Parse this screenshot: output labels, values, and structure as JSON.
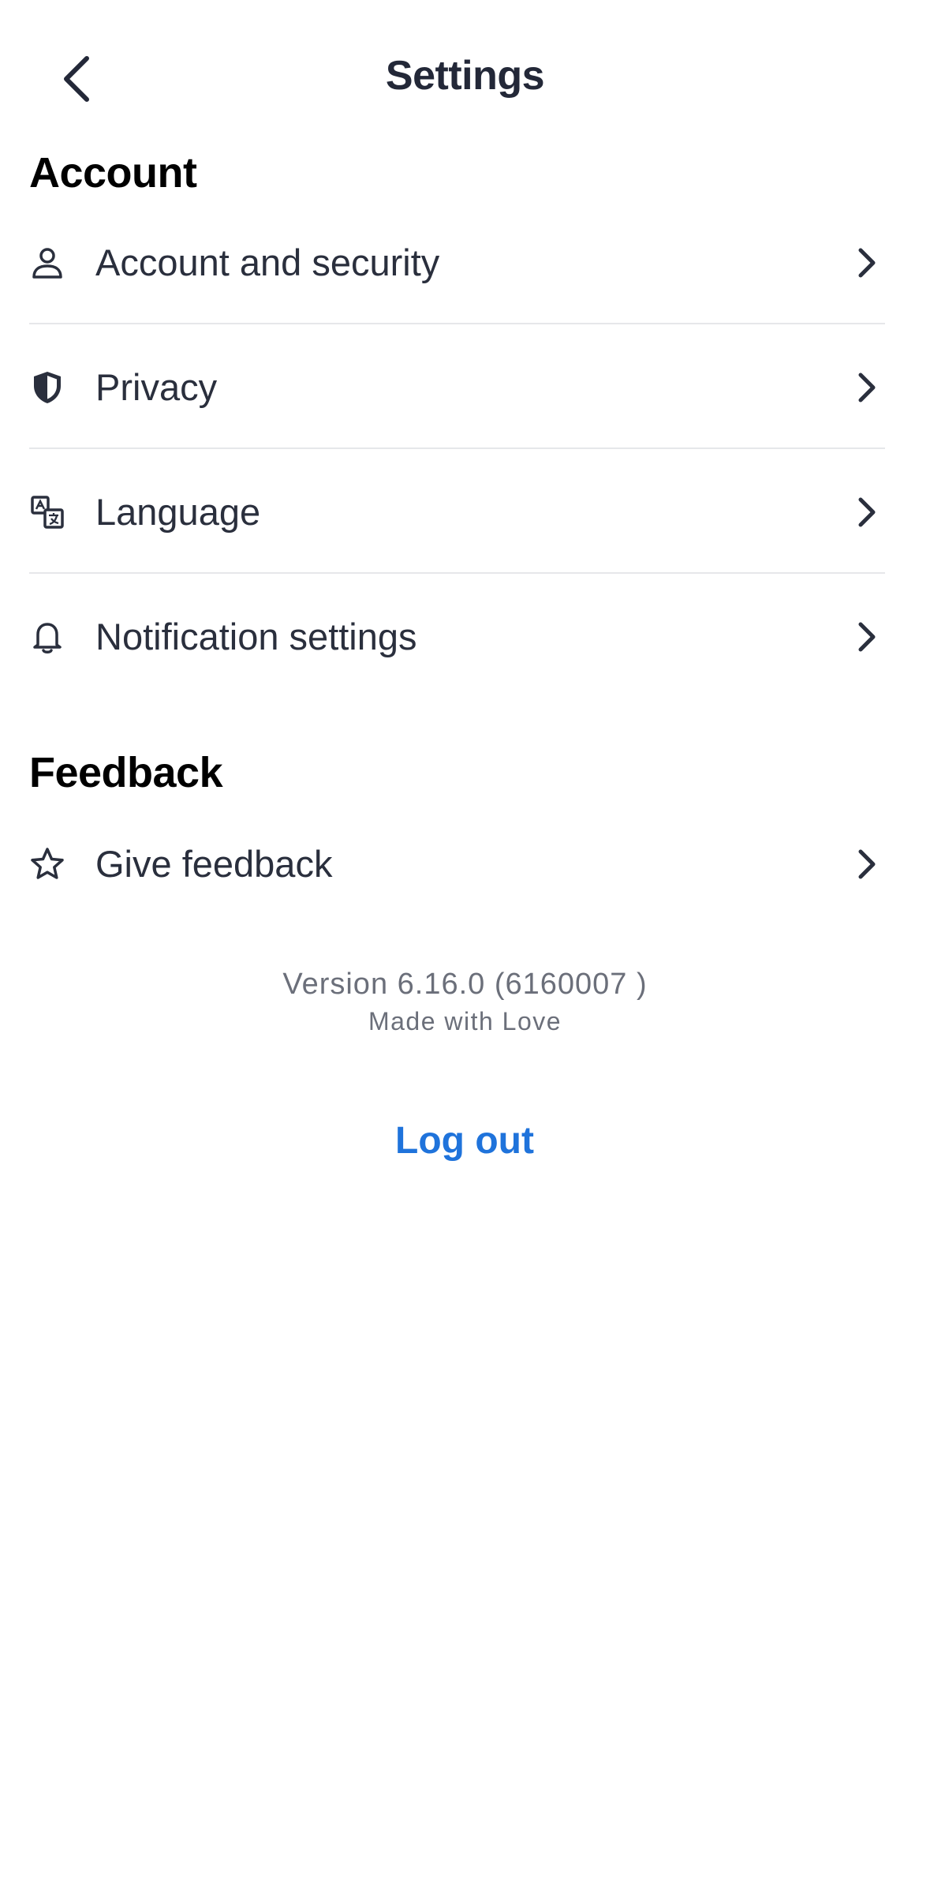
{
  "header": {
    "title": "Settings",
    "back_icon": "chevron-left-icon"
  },
  "account_section": {
    "heading": "Account",
    "items": [
      {
        "label": "Account and security",
        "icon": "person-icon"
      },
      {
        "label": "Privacy",
        "icon": "shield-icon"
      },
      {
        "label": "Language",
        "icon": "translate-icon"
      },
      {
        "label": "Notification settings",
        "icon": "bell-icon"
      }
    ]
  },
  "feedback_section": {
    "heading": "Feedback",
    "items": [
      {
        "label": "Give feedback",
        "icon": "star-icon"
      }
    ]
  },
  "footer": {
    "version": "Version 6.16.0 (6160007 )",
    "tagline": "Made with Love",
    "logout_label": "Log out"
  },
  "colors": {
    "accent": "#1f73db",
    "text_primary": "#2a2f3d",
    "text_secondary": "#6b6f7a",
    "divider": "#e6e7ea"
  }
}
